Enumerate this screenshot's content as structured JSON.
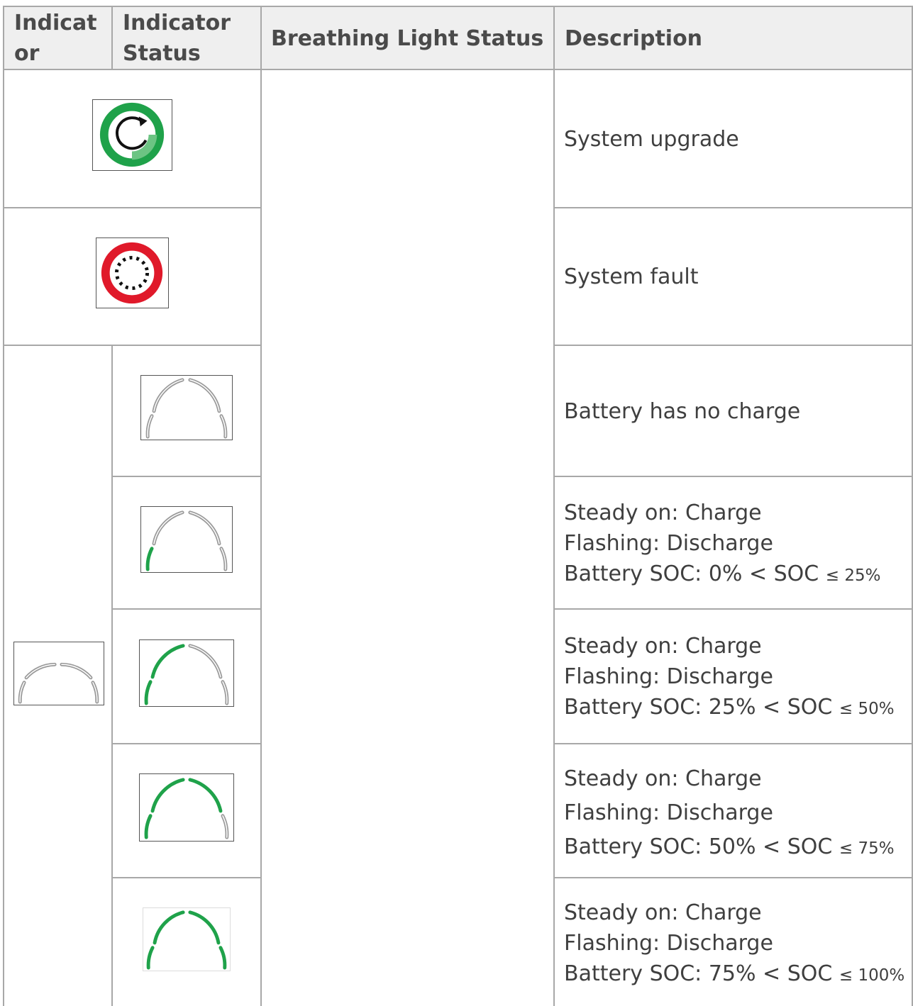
{
  "table": {
    "headers": {
      "indicator": "Indicat or",
      "indicator_line1": "Indicat",
      "indicator_line2": "or",
      "indicator_status_line1": "Indicator",
      "indicator_status_line2": "Status",
      "breathing_light_status": "Breathing Light Status",
      "description": "Description"
    },
    "rows": [
      {
        "icon": "system-upgrade-icon",
        "description": "System upgrade"
      },
      {
        "icon": "system-fault-icon",
        "description": "System fault"
      },
      {
        "icon": "battery-arc-empty-icon",
        "description": "Battery has no charge"
      },
      {
        "icon": "battery-arc-1-segment-icon",
        "line1": "Steady on: Charge",
        "line2": "Flashing: Discharge",
        "line3_main": "Battery SOC: 0% < SOC ",
        "line3_small": "≤ 25%"
      },
      {
        "icon": "battery-arc-2-segments-icon",
        "line1": "Steady on: Charge",
        "line2": "Flashing: Discharge",
        "line3_main": "Battery SOC: 25% < SOC ",
        "line3_small": "≤ 50%"
      },
      {
        "icon": "battery-arc-3-segments-icon",
        "line1": "Steady on: Charge",
        "line2": "Flashing: Discharge",
        "line3_main": "Battery SOC: 50% < SOC ",
        "line3_small": "≤ 75%"
      },
      {
        "icon": "battery-arc-4-segments-icon",
        "line1": "Steady on: Charge",
        "line2": "Flashing: Discharge",
        "line3_main": "Battery SOC: 75% < SOC ",
        "line3_small": "≤ 100%"
      }
    ],
    "group_indicator_icon": "battery-arc-indicator-icon"
  },
  "colors": {
    "header_bg": "#efefef",
    "border": "#a8a8a8",
    "ok_green": "#1fa24a",
    "fault_red": "#e0192a",
    "arc_gray": "#9a9a9a"
  }
}
